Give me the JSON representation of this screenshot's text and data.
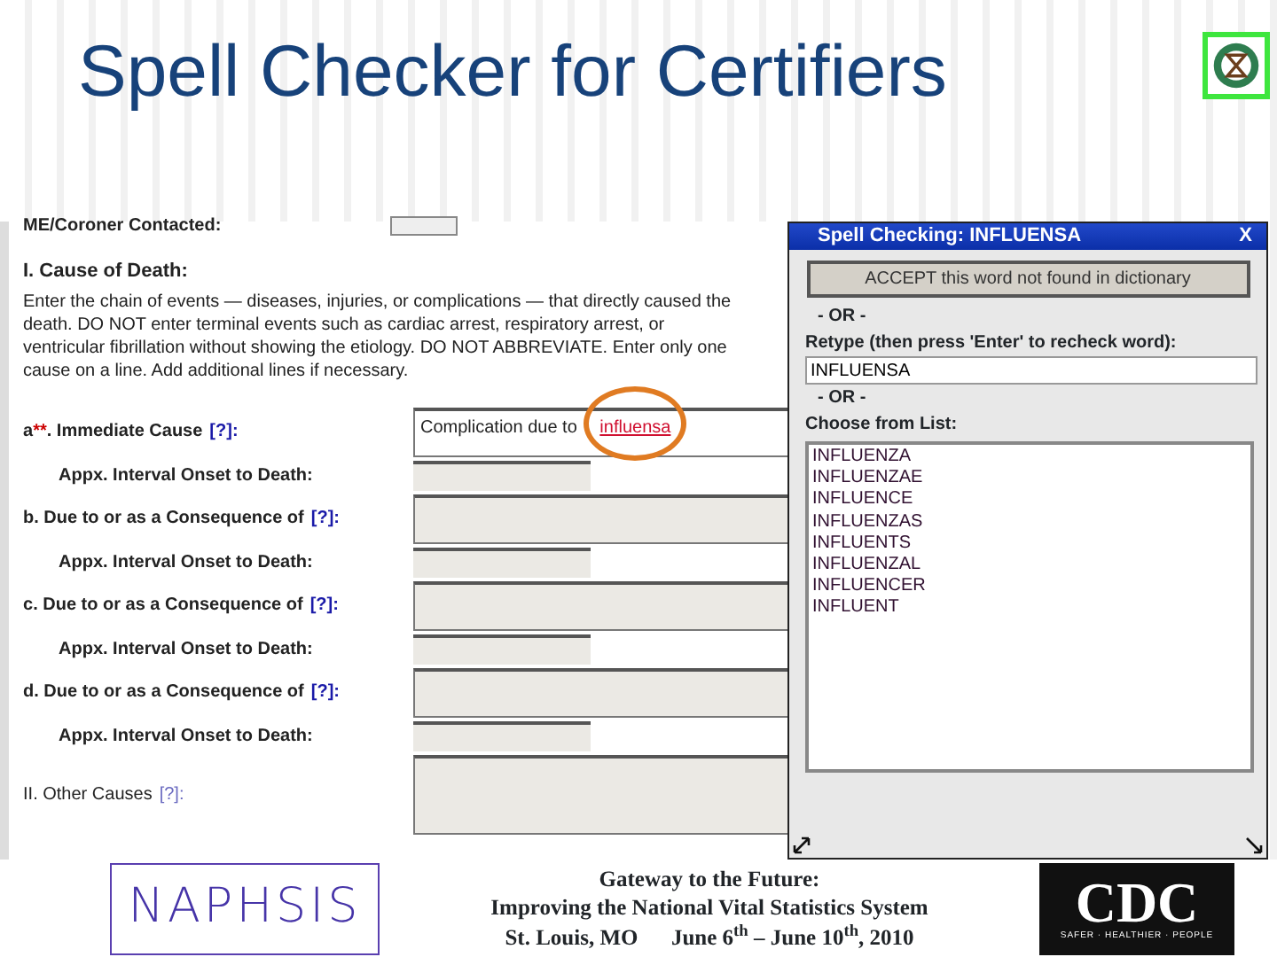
{
  "slide": {
    "title": "Spell Checker for Certifiers"
  },
  "form": {
    "top_row": {
      "label": "ME/Coroner Contacted:"
    },
    "section_heading": "I. Cause of Death:",
    "instructions": "Enter the chain of events — diseases, injuries, or complications — that directly caused the death. DO NOT enter terminal events such as cardiac arrest, respiratory arrest, or ventricular fibrillation without showing the etiology. DO NOT ABBREVIATE. Enter only one cause on a line. Add additional lines if necessary.",
    "rows": [
      {
        "kind": "cause",
        "letter": "a",
        "required_mark": "**",
        "label": ". Immediate Cause",
        "help": "[?]:",
        "value_text": "Complication due to ",
        "flagged_word": "influensa"
      },
      {
        "kind": "interval",
        "label": "Appx. Interval Onset to Death:"
      },
      {
        "kind": "cause",
        "letter": "b",
        "label": ". Due to or as a Consequence of",
        "help": "[?]:"
      },
      {
        "kind": "interval",
        "label": "Appx. Interval Onset to Death:"
      },
      {
        "kind": "cause",
        "letter": "c",
        "label": ". Due to or as a Consequence of",
        "help": "[?]:"
      },
      {
        "kind": "interval",
        "label": "Appx. Interval Onset to Death:"
      },
      {
        "kind": "cause",
        "letter": "d",
        "label": ". Due to or as a Consequence of",
        "help": "[?]:"
      },
      {
        "kind": "interval",
        "label": "Appx. Interval Onset to Death:"
      },
      {
        "kind": "other",
        "letter": "II",
        "label": ". Other Causes",
        "help": "[?]:"
      }
    ]
  },
  "spell_dialog": {
    "title": "Spell Checking: INFLUENSA",
    "close": "X",
    "accept_button": "ACCEPT this word not found in dictionary",
    "or_1": "- OR -",
    "retype_label": "Retype (then press 'Enter' to recheck word):",
    "retype_value": "INFLUENSA",
    "or_2": "- OR -",
    "list_label": "Choose from List:",
    "suggestions": [
      "INFLUENZA",
      "INFLUENZAE",
      "INFLUENCE",
      "INFLUENZAS",
      "INFLUENTS",
      "INFLUENZAL",
      "INFLUENCER",
      "INFLUENT"
    ]
  },
  "footer": {
    "left_logo": "NAPHSIS",
    "lines": [
      "Gateway to the Future:",
      "Improving the National Vital Statistics System",
      "St. Louis, MO      June 6$^{th}$ – June 10$^{th}$, 2010"
    ],
    "right_logo": "CDC",
    "right_tagline": "SAFER · HEALTHIER · PEOPLE"
  }
}
